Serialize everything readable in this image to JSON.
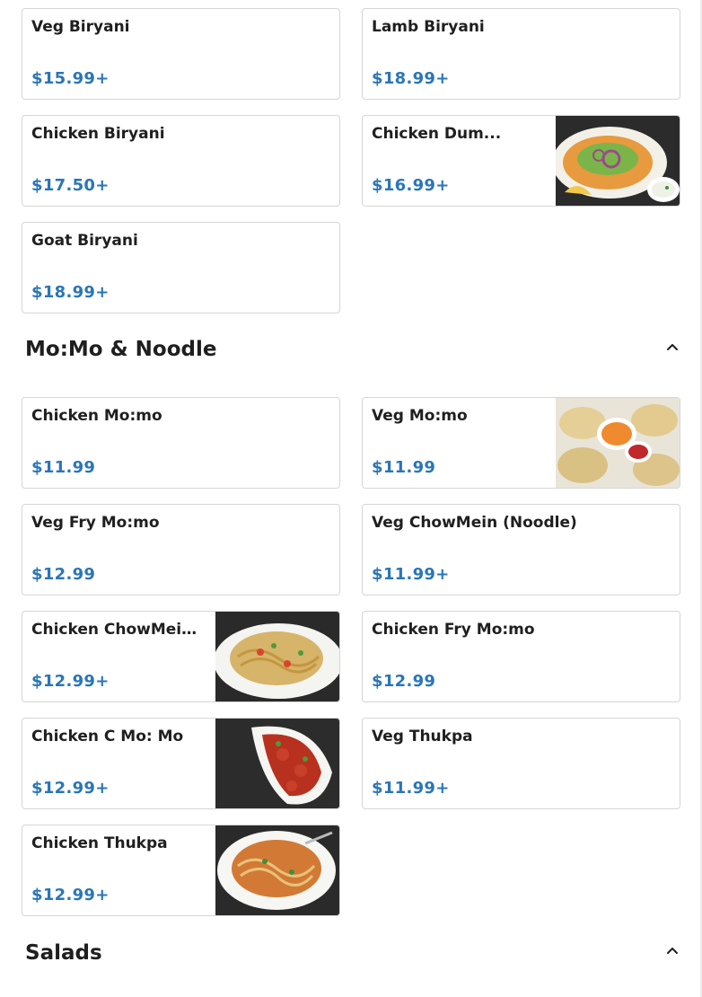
{
  "biryani": {
    "items": [
      {
        "name": "Veg Biryani",
        "price": "$15.99+"
      },
      {
        "name": "Lamb Biryani",
        "price": "$18.99+"
      },
      {
        "name": "Chicken Biryani",
        "price": "$17.50+"
      },
      {
        "name": "Chicken Dum...",
        "price": "$16.99+"
      },
      {
        "name": "Goat Biryani",
        "price": "$18.99+"
      }
    ]
  },
  "momo_noodle": {
    "title": "Mo:Mo & Noodle",
    "items": [
      {
        "name": "Chicken Mo:mo",
        "price": "$11.99"
      },
      {
        "name": "Veg Mo:mo",
        "price": "$11.99"
      },
      {
        "name": "Veg Fry Mo:mo",
        "price": "$12.99"
      },
      {
        "name": "Veg ChowMein (Noodle)",
        "price": "$11.99+"
      },
      {
        "name": "Chicken ChowMein...",
        "price": "$12.99+"
      },
      {
        "name": "Chicken Fry Mo:mo",
        "price": "$12.99"
      },
      {
        "name": "Chicken C Mo: Mo",
        "price": "$12.99+"
      },
      {
        "name": "Veg Thukpa",
        "price": "$11.99+"
      },
      {
        "name": "Chicken Thukpa",
        "price": "$12.99+"
      }
    ]
  },
  "salads": {
    "title": "Salads"
  },
  "icons": {
    "collapse": "chevron-up-icon"
  },
  "colors": {
    "price": "#2a76b6",
    "card_border": "#d6d6d6"
  }
}
